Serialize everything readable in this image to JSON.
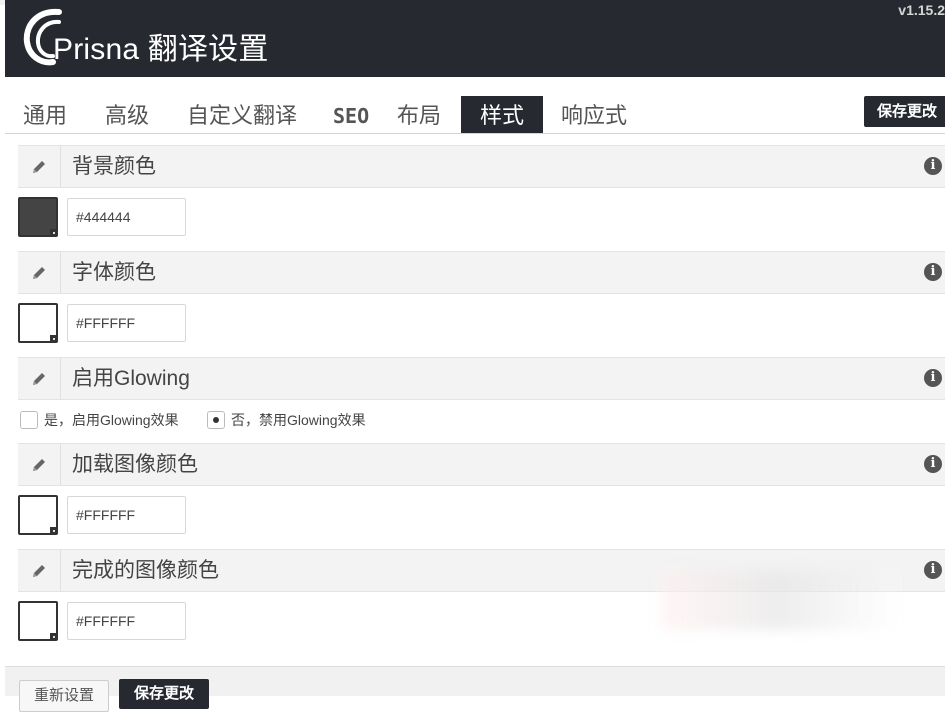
{
  "header": {
    "brand_title": "Prisna 翻译设置",
    "version": "v1.15.2",
    "background_color": "#262a30"
  },
  "tabs": [
    {
      "label": "通用",
      "active": false
    },
    {
      "label": "高级",
      "active": false
    },
    {
      "label": "自定义翻译",
      "active": false
    },
    {
      "label": "SEO",
      "active": false
    },
    {
      "label": "布局",
      "active": false
    },
    {
      "label": "样式",
      "active": true
    },
    {
      "label": "响应式",
      "active": false
    }
  ],
  "save_top_label": "保存更改",
  "sections": {
    "background_color": {
      "title": "背景颜色",
      "value": "#444444",
      "swatch": "#444444"
    },
    "font_color": {
      "title": "字体颜色",
      "value": "#FFFFFF",
      "swatch": "#FFFFFF"
    },
    "glowing": {
      "title": "启用Glowing",
      "options": [
        {
          "label": "是，启用Glowing效果",
          "checked": false
        },
        {
          "label": "否，禁用Glowing效果",
          "checked": true
        }
      ]
    },
    "loading_image_color": {
      "title": "加载图像颜色",
      "value": "#FFFFFF",
      "swatch": "#FFFFFF"
    },
    "completed_image_color": {
      "title": "完成的图像颜色",
      "value": "#FFFFFF",
      "swatch": "#FFFFFF"
    }
  },
  "icons": {
    "section": "pencil-icon",
    "help": "info-icon",
    "info_glyph": "i"
  },
  "footer": {
    "reset_label": "重新设置",
    "save_label": "保存更改"
  }
}
